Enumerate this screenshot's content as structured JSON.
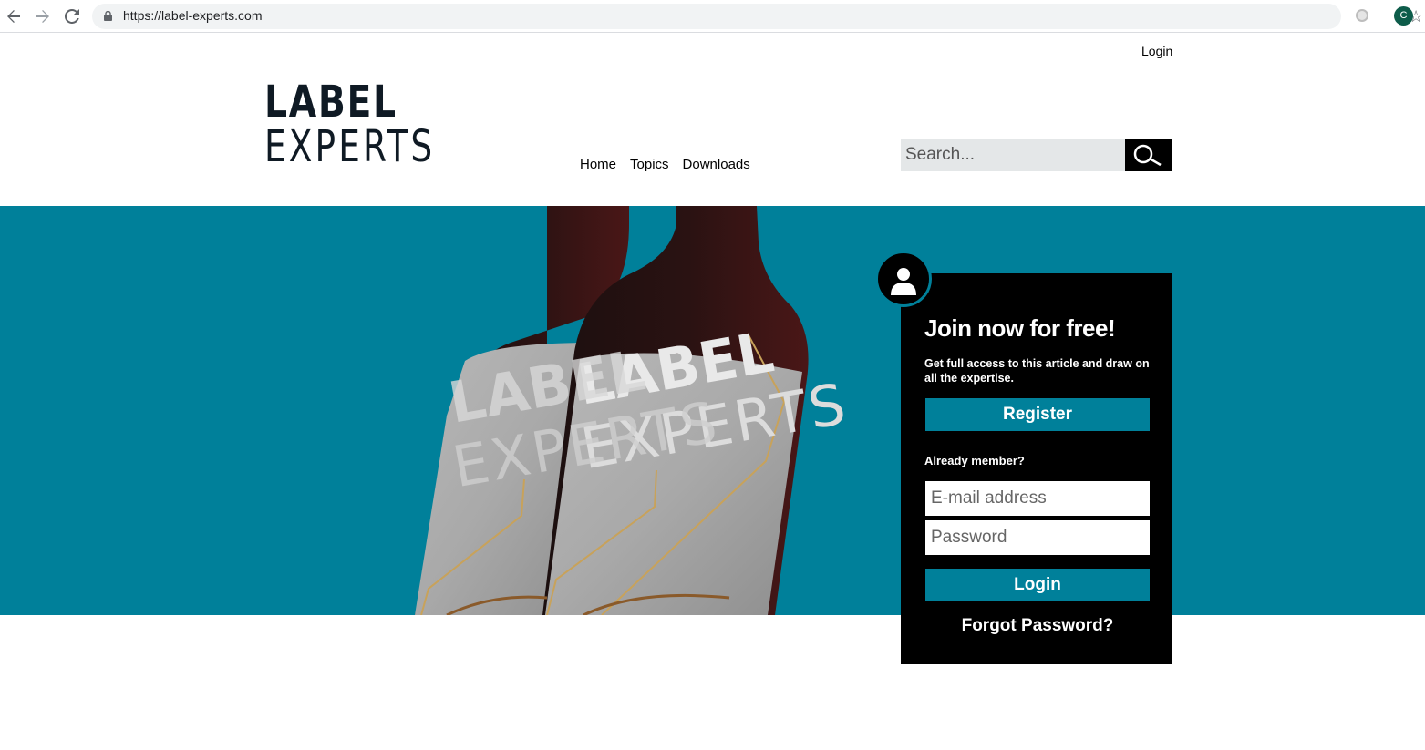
{
  "browser": {
    "url": "https://label-experts.com",
    "profile_initial": "C"
  },
  "header": {
    "login_link": "Login",
    "logo_line1": "LABEL",
    "logo_line2": "EXPERTS",
    "nav": [
      {
        "label": "Home",
        "active": true
      },
      {
        "label": "Topics"
      },
      {
        "label": "Downloads"
      }
    ],
    "search_placeholder": "Search..."
  },
  "hero": {
    "bottle_label_line1": "LABEL",
    "bottle_label_line2": "EXPERTS",
    "background_color": "#00809a"
  },
  "login_panel": {
    "title": "Join now for free!",
    "description": "Get full access to this article and draw on all the expertise.",
    "register_label": "Register",
    "already_member": "Already member?",
    "email_placeholder": "E-mail address",
    "password_placeholder": "Password",
    "login_label": "Login",
    "forgot_label": "Forgot Password?"
  }
}
